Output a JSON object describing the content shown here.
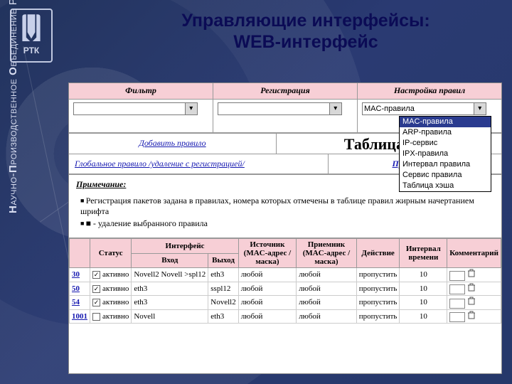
{
  "brand": {
    "short": "РТК",
    "long_prefix": "Н",
    "long_rest1": "АУЧНО-",
    "long_prefix2": "П",
    "long_rest2": "РОИЗВОДСТВЕННОЕ ",
    "long_prefix3": "О",
    "long_rest3": "БЪЕДИНЕНИЕ РТК"
  },
  "title": {
    "l1": "Управляющие интерфейсы:",
    "l2": "WEB-интерфейс"
  },
  "top": {
    "filter": {
      "label": "Фильтр"
    },
    "reg": {
      "label": "Регистрация"
    },
    "rules": {
      "label": "Настройка правил",
      "selected": "MAC-правила"
    }
  },
  "dropdown_items": [
    "MAC-правила",
    "ARP-правила",
    "IP-сервис",
    "IPX-правила",
    "Интервал правила",
    "Сервис правила",
    "Таблица хэша"
  ],
  "links": {
    "add_rule": "Добавить правило",
    "global_rule": "Глобальное правило /удаление с регистрацией/",
    "apply": "Применить"
  },
  "heading": "Таблица MA",
  "note": {
    "title": "Примечание:",
    "i1": "Регистрация пакетов задана в правилах, номера которых отмечены в таблице правил жирным начертанием шрифта",
    "i2": "■ - удаление выбранного правила"
  },
  "cols": {
    "num": "",
    "status": "Статус",
    "iface": "Интерфейс",
    "in": "Вход",
    "out": "Выход",
    "src": "Источник (MAC-адрес / маска)",
    "dst": "Приемник (MAC-адрес / маска)",
    "action": "Действие",
    "interval": "Интервал времени",
    "comment": "Комментарий"
  },
  "status_active": "активно",
  "placeholders": {
    "any": "любой",
    "skip": "пропустить",
    "ten": "10"
  },
  "rows": [
    {
      "n": "30",
      "if1a": "Novell2",
      "if1b": "Novell >spl12",
      "if2": "eth3"
    },
    {
      "n": "50",
      "if1a": "",
      "if1b": "eth3",
      "if2": "sspl12"
    },
    {
      "n": "54",
      "if1a": "",
      "if1b": "eth3",
      "if2": "Novell2"
    },
    {
      "n": "1001",
      "if1a": "",
      "if1b": "Novell",
      "if2": "eth3"
    }
  ]
}
